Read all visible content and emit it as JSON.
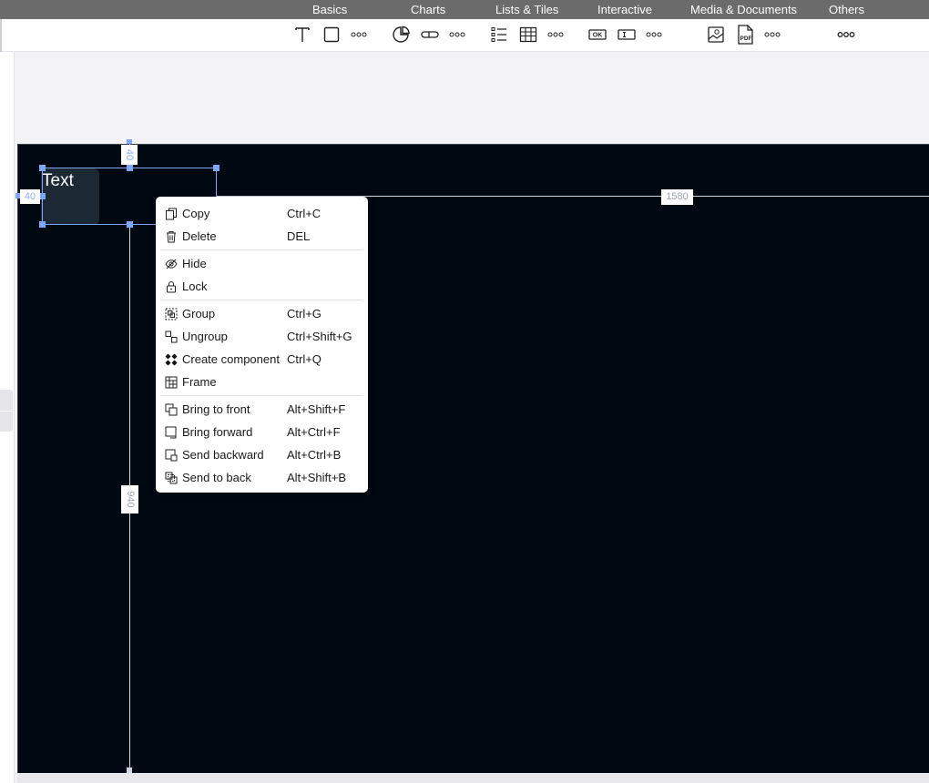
{
  "categories": [
    {
      "label": "Basics"
    },
    {
      "label": "Charts"
    },
    {
      "label": "Lists & Tiles"
    },
    {
      "label": "Interactive"
    },
    {
      "label": "Media & Documents"
    },
    {
      "label": "Others"
    }
  ],
  "toolbar": {
    "icons": [
      {
        "name": "text-tool-icon"
      },
      {
        "name": "rectangle-tool-icon"
      },
      {
        "name": "basics-more-icon"
      },
      {
        "name": "pie-chart-icon"
      },
      {
        "name": "progress-bar-icon"
      },
      {
        "name": "charts-more-icon"
      },
      {
        "name": "list-icon"
      },
      {
        "name": "table-icon"
      },
      {
        "name": "lists-more-icon"
      },
      {
        "name": "ok-button-icon"
      },
      {
        "name": "input-field-icon"
      },
      {
        "name": "interactive-more-icon"
      },
      {
        "name": "image-icon"
      },
      {
        "name": "pdf-icon"
      },
      {
        "name": "media-more-icon"
      },
      {
        "name": "others-more-icon"
      }
    ],
    "ok_label": "OK",
    "pdf_label": "PDF"
  },
  "canvas": {
    "element_text": "Text",
    "offset_top": "40",
    "offset_left": "40",
    "canvas_width": "1580",
    "canvas_height": "940"
  },
  "context_menu": {
    "groups": [
      [
        {
          "label": "Copy",
          "shortcut": "Ctrl+C",
          "icon": "copy-icon"
        },
        {
          "label": "Delete",
          "shortcut": "DEL",
          "icon": "trash-icon"
        }
      ],
      [
        {
          "label": "Hide",
          "shortcut": "",
          "icon": "eye-off-icon"
        },
        {
          "label": "Lock",
          "shortcut": "",
          "icon": "lock-icon"
        }
      ],
      [
        {
          "label": "Group",
          "shortcut": "Ctrl+G",
          "icon": "group-icon"
        },
        {
          "label": "Ungroup",
          "shortcut": "Ctrl+Shift+G",
          "icon": "ungroup-icon"
        },
        {
          "label": "Create component",
          "shortcut": "Ctrl+Q",
          "icon": "component-icon"
        },
        {
          "label": "Frame",
          "shortcut": "",
          "icon": "frame-icon"
        }
      ],
      [
        {
          "label": "Bring to front",
          "shortcut": "Alt+Shift+F",
          "icon": "bring-to-front-icon"
        },
        {
          "label": "Bring forward",
          "shortcut": "Alt+Ctrl+F",
          "icon": "bring-forward-icon"
        },
        {
          "label": "Send backward",
          "shortcut": "Alt+Ctrl+B",
          "icon": "send-backward-icon"
        },
        {
          "label": "Send to back",
          "shortcut": "Alt+Shift+B",
          "icon": "send-to-back-icon"
        }
      ]
    ]
  },
  "colors": {
    "category_bar": "#6b6b6b",
    "canvas_bg": "#000812",
    "selection": "#7da6ff",
    "menu_bg": "#ffffff"
  }
}
